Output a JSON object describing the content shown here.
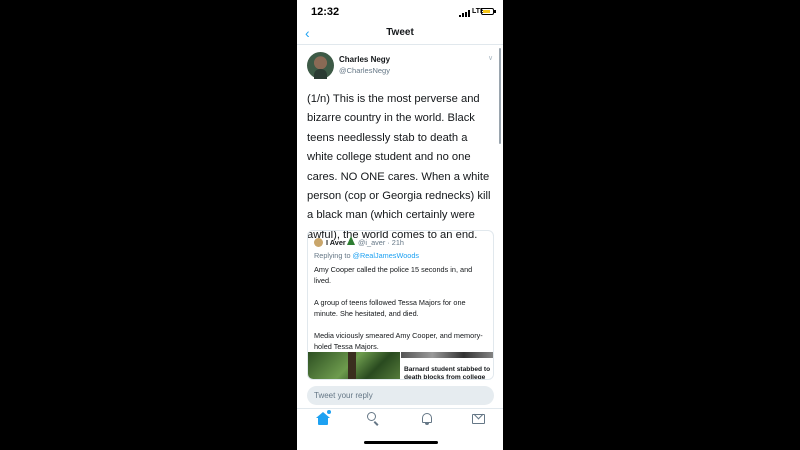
{
  "status_bar": {
    "time": "12:32",
    "network": "LTE"
  },
  "header": {
    "back_icon": "chevron-left-icon",
    "title": "Tweet"
  },
  "tweet": {
    "author_name": "Charles Negy",
    "author_handle": "@CharlesNegy",
    "body": "(1/n) This is the most perverse and bizarre country in the world. Black teens needlessly stab to death a white college student and no one cares. NO ONE cares. When a white person (cop or Georgia rednecks) kill a black man (which certainly were awful), the world comes to an end."
  },
  "quoted_tweet": {
    "author_name": "I Aver",
    "author_handle": "@i_aver",
    "time": "· 21h",
    "replying_prefix": "Replying to ",
    "replying_to": "@RealJamesWoods",
    "text": "Amy Cooper called the police 15 seconds in, and lived.\n\nA group of teens followed Tessa Majors for one minute.  She hesitated, and died.\n\nMedia viciously smeared Amy Cooper, and memory-holed Tessa Majors.",
    "card_headline": "Barnard student stabbed to death blocks from college"
  },
  "reply": {
    "placeholder": "Tweet your reply"
  },
  "tab_bar": {
    "items": [
      "home-icon",
      "search-icon",
      "bell-icon",
      "mail-icon"
    ]
  },
  "colors": {
    "accent": "#1da1f2",
    "text": "#14171a",
    "secondary": "#657786"
  }
}
